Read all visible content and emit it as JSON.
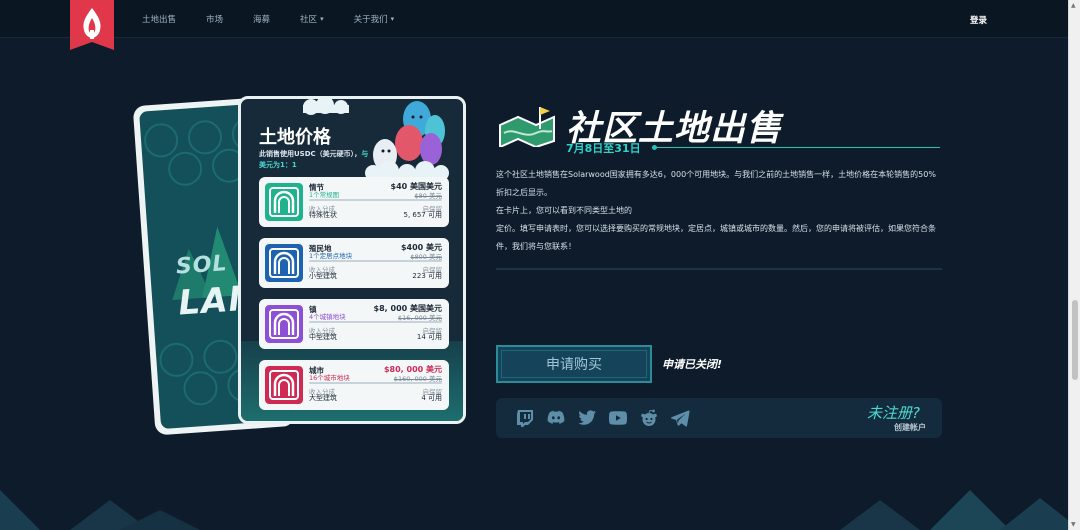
{
  "nav": {
    "items": [
      {
        "label": "土地出售",
        "caret": ""
      },
      {
        "label": "市场",
        "caret": ""
      },
      {
        "label": "海募",
        "caret": ""
      },
      {
        "label": "社区",
        "caret": "▾"
      },
      {
        "label": "关于我们",
        "caret": "▾"
      }
    ],
    "login": "登录"
  },
  "back_card": {
    "line1": "SOL",
    "line2": "LAN"
  },
  "price_card": {
    "title": "土地价格",
    "subtitle_a": "此销售使用USDC（美元硬币），",
    "subtitle_b": "与美元为1：1",
    "lands": [
      {
        "name": "情节",
        "desc": "1个常规图",
        "price": "$40 美国美元",
        "old_price": "$80 美元",
        "left_label": "收入分成",
        "left_value": "特殊性状",
        "right_label": "启保留",
        "right_value": "5, 657 可用",
        "color": "#1fb28d"
      },
      {
        "name": "殖民地",
        "desc": "1个定居点地块",
        "price": "$400 美元",
        "old_price": "$800 美元",
        "left_label": "收入分成",
        "left_value": "小型建筑",
        "right_label": "启保留",
        "right_value": "223 可用",
        "color": "#1d63b0"
      },
      {
        "name": "镇",
        "desc": "4个城镇地块",
        "price": "$8, 000 美国美元",
        "old_price": "$16, 000 美元",
        "left_label": "收入分成",
        "left_value": "中型建筑",
        "right_label": "启保留",
        "right_value": "14 可用",
        "color": "#8d4fd6"
      },
      {
        "name": "城市",
        "desc": "16个城市地块",
        "price": "$80, 000 美元",
        "old_price": "$160, 000 美元",
        "left_label": "收入分成",
        "left_value": "大型建筑",
        "right_label": "启保留",
        "right_value": "4 可用",
        "color": "#cf2a54"
      }
    ]
  },
  "hero": {
    "title": "社区土地出售",
    "date": "7月8日至31日",
    "paragraphs": [
      "这个社区土地销售在Solarwood国家拥有多达6，000个可用地块。与我们之前的土地销售一样，土地价格在本轮销售的50%折扣之后显示。",
      "在卡片上，您可以看到不同类型土地的",
      "定价。填写申请表时，您可以选择要购买的常规地块，定居点，城镇或城市的数量。然后，您的申请将被评估，如果您符合条件，我们将与您联系！"
    ]
  },
  "apply": {
    "button": "申请购买",
    "status": "申请已关闭!"
  },
  "social": {
    "icons": [
      "twitch-icon",
      "discord-icon",
      "twitter-icon",
      "youtube-icon",
      "reddit-icon",
      "telegram-icon"
    ],
    "unregistered": "未注册?",
    "create_account": "创建帐户"
  },
  "colors": {
    "accent": "#2fd1c8",
    "background": "#0d1b2a",
    "nav": "#0a1622"
  }
}
